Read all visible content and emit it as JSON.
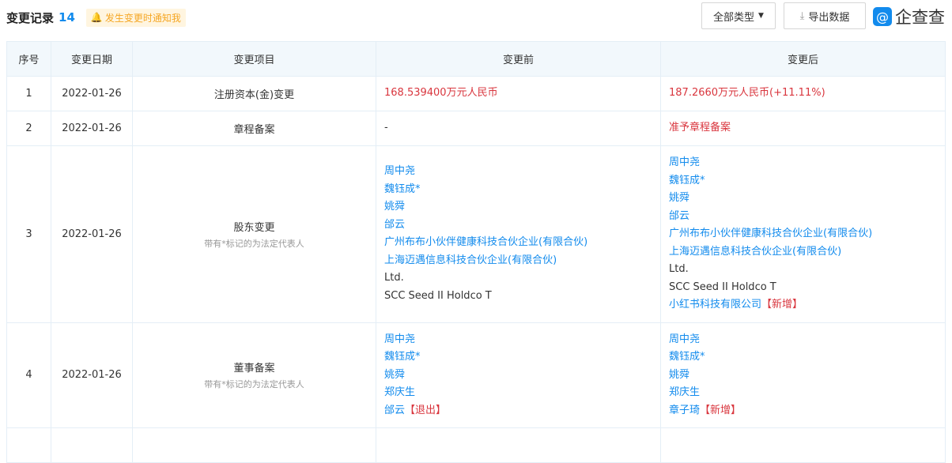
{
  "header": {
    "title": "变更记录",
    "count": "14",
    "notify": "发生变更时通知我"
  },
  "toolbar": {
    "type_filter": "全部类型",
    "export": "导出数据"
  },
  "logo": {
    "text": "企查查"
  },
  "columns": [
    "序号",
    "变更日期",
    "变更项目",
    "变更前",
    "变更后"
  ],
  "legal_note": "带有*标记的为法定代表人",
  "rows": [
    {
      "no": "1",
      "date": "2022-01-26",
      "item": "注册资本(金)变更",
      "before": "168.539400万元人民币",
      "after": "187.2660万元人民币(+11.11%)"
    },
    {
      "no": "2",
      "date": "2022-01-26",
      "item": "章程备案",
      "before": "-",
      "after": "准予章程备案"
    },
    {
      "no": "3",
      "date": "2022-01-26",
      "item": "股东变更",
      "before": [
        "周中尧",
        "魏钰成*",
        "姚舜",
        "邰云",
        "广州布布小伙伴健康科技合伙企业(有限合伙)",
        "上海迈遇信息科技合伙企业(有限合伙)",
        "Ltd.",
        "SCC Seed II Holdco T"
      ],
      "after": [
        "周中尧",
        "魏钰成*",
        "姚舜",
        "邰云",
        "广州布布小伙伴健康科技合伙企业(有限合伙)",
        "上海迈遇信息科技合伙企业(有限合伙)",
        "Ltd.",
        "SCC Seed II Holdco T",
        "小红书科技有限公司"
      ],
      "after_tag": "【新增】"
    },
    {
      "no": "4",
      "date": "2022-01-26",
      "item": "董事备案",
      "before": [
        "周中尧",
        "魏钰成*",
        "姚舜",
        "郑庆生",
        "邰云"
      ],
      "before_tag": "【退出】",
      "after": [
        "周中尧",
        "魏钰成*",
        "姚舜",
        "郑庆生",
        "章子琦"
      ],
      "after_tag": "【新增】"
    }
  ]
}
